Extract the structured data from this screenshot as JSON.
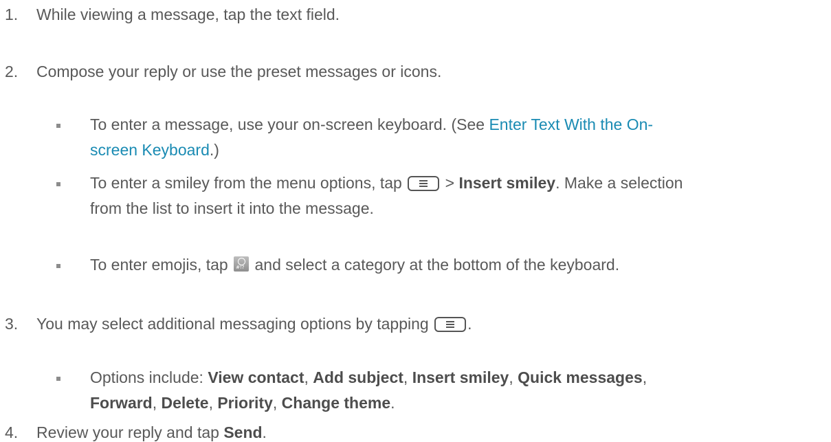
{
  "steps": [
    {
      "num": "1.",
      "text": "While viewing a message, tap the text field."
    },
    {
      "num": "2.",
      "text": "Compose your reply or use the preset messages or icons."
    },
    {
      "num": "3.",
      "text_a": "You may select additional messaging options by tapping",
      "text_b": "."
    },
    {
      "num": "4.",
      "text_a": "Review your reply and tap ",
      "bold": "Send",
      "text_b": "."
    }
  ],
  "bullets": {
    "b1": {
      "line1_a": "To enter a message, use your on-screen keyboard. (See ",
      "link_part1": "Enter Text With the On-",
      "link_part2": "screen Keyboard",
      "line2_b": ".)"
    },
    "b2": {
      "line1_a": "To enter a smiley from the menu options, tap",
      "line1_b": " > ",
      "bold": "Insert smiley",
      "line1_c": ". Make a selection",
      "line2": "from the list to insert it into the message."
    },
    "b3": {
      "text_a": "To enter emojis, tap",
      "text_b": " and select a category at the bottom of the keyboard."
    },
    "b4": {
      "label": "Options include: ",
      "opt1": "View contact",
      "opt2": "Add subject",
      "opt3": "Insert smiley",
      "opt4": "Quick messages",
      "opt5": "Forward",
      "opt6": "Delete",
      "opt7": "Priority",
      "opt8": "Change theme",
      "sep": ", ",
      "end": "."
    }
  },
  "icons": {
    "menu_key": "menu-key-icon",
    "emoji_key": "emoji-keyboard-icon"
  }
}
